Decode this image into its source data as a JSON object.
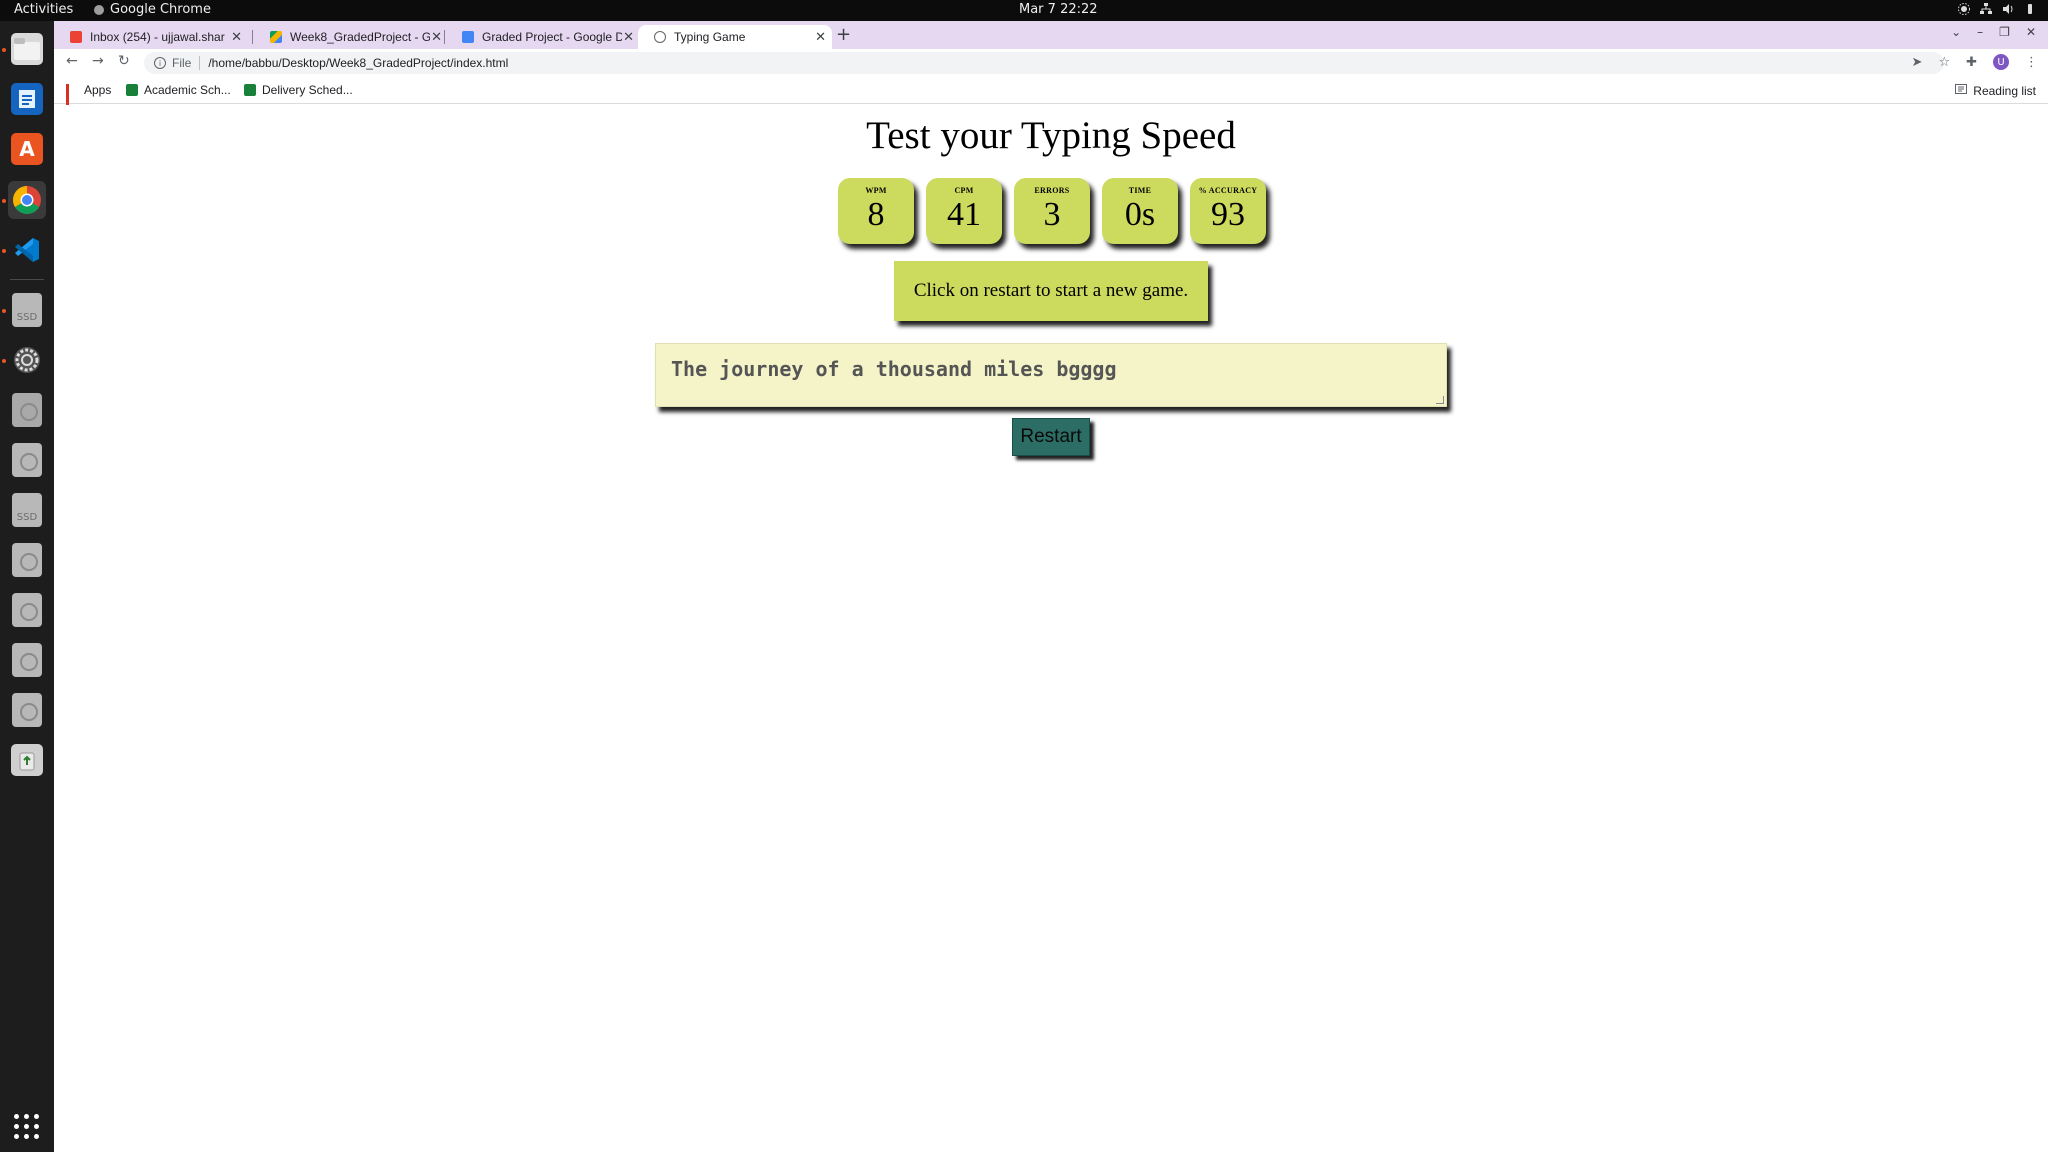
{
  "os": {
    "activities": "Activities",
    "app_name": "Google Chrome",
    "clock": "Mar 7  22:22"
  },
  "dock": {
    "items": [
      "files-icon",
      "writer-icon",
      "software-icon",
      "chrome-icon",
      "vscode-icon",
      "ssd-drive-icon",
      "settings-icon",
      "drive-icon",
      "disk-icon",
      "ssd-drive-icon",
      "disk-icon",
      "disk-icon",
      "disk-icon",
      "disk-icon",
      "trash-icon"
    ],
    "ssd_label": "SSD"
  },
  "browser": {
    "tabs": [
      {
        "title": "Inbox (254) - ujjawal.shar",
        "icon": "gmail-icon",
        "active": false
      },
      {
        "title": "Week8_GradedProject - G",
        "icon": "drive-icon",
        "active": false
      },
      {
        "title": "Graded Project - Google D",
        "icon": "docs-icon",
        "active": false
      },
      {
        "title": "Typing Game",
        "icon": "globe-icon",
        "active": true
      }
    ],
    "new_tab": "+",
    "url_scheme": "File",
    "url": "/home/babbu/Desktop/Week8_GradedProject/index.html",
    "avatar_letter": "U",
    "bookmarks": [
      {
        "label": "Apps"
      },
      {
        "label": "Academic Sch..."
      },
      {
        "label": "Delivery Sched..."
      }
    ],
    "reading_list": "Reading list"
  },
  "page": {
    "heading": "Test your Typing Speed",
    "stats": [
      {
        "label": "WPM",
        "value": "8"
      },
      {
        "label": "CPM",
        "value": "41"
      },
      {
        "label": "ERRORS",
        "value": "3"
      },
      {
        "label": "TIME",
        "value": "0s"
      },
      {
        "label": "% ACCURACY",
        "value": "93"
      }
    ],
    "quote": "Click on restart to start a new game.",
    "input_text": "The journey of a thousand miles bgggg",
    "restart_label": "Restart"
  },
  "colors": {
    "stat_bg": "#ccdb5e",
    "input_bg": "#f4f4c8",
    "restart_bg": "#2c6e66",
    "tabstrip_bg": "#e7d8f1"
  }
}
